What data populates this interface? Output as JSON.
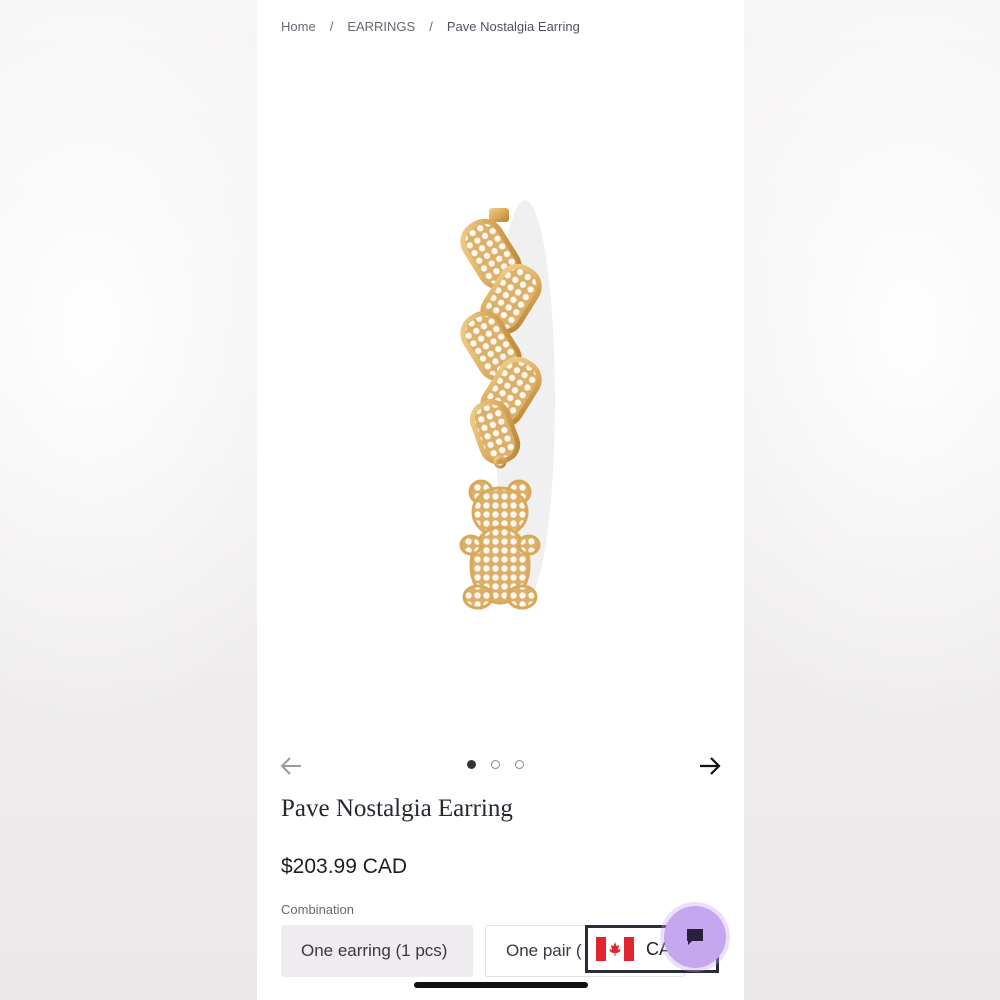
{
  "breadcrumb": {
    "home": "Home",
    "separator": "/",
    "category": "EARRINGS",
    "current": "Pave Nostalgia Earring"
  },
  "carousel": {
    "prev_icon": "arrow-left-icon",
    "next_icon": "arrow-right-icon",
    "total_slides": 3,
    "active_slide": 1
  },
  "product": {
    "title": "Pave Nostalgia Earring",
    "price": "$203.99 CAD"
  },
  "options": {
    "label": "Combination",
    "items": [
      "One earring (1 pcs)",
      "One pair ("
    ],
    "selected": "One earring (1 pcs)"
  },
  "currency_selector": {
    "code": "CA",
    "flag_icon": "canada-flag-icon"
  },
  "chat": {
    "icon": "chat-bubble-icon",
    "color": "#c4a7ee"
  },
  "colors": {
    "gold": "#d9a85a",
    "text": "#2a2630"
  }
}
